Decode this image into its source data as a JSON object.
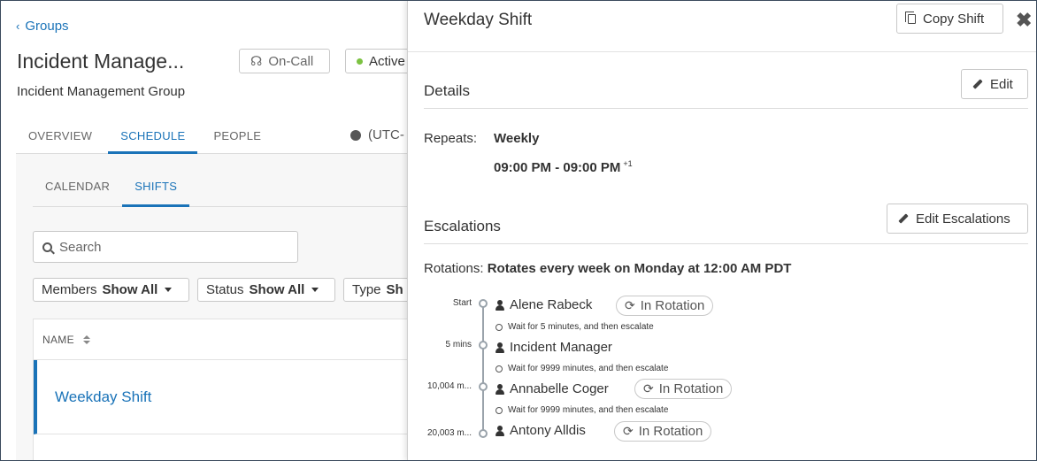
{
  "left": {
    "back_label": "Groups",
    "group_title": "Incident Manage...",
    "group_subtitle": "Incident Management Group",
    "oncall_label": "On-Call",
    "status_label": "Active",
    "tabs": [
      {
        "label": "OVERVIEW"
      },
      {
        "label": "SCHEDULE"
      },
      {
        "label": "PEOPLE"
      }
    ],
    "timezone": "(UTC-",
    "subtabs": [
      {
        "label": "CALENDAR"
      },
      {
        "label": "SHIFTS"
      }
    ],
    "search_placeholder": "Search",
    "filters": [
      {
        "label": "Members",
        "value": "Show All"
      },
      {
        "label": "Status",
        "value": "Show All"
      },
      {
        "label": "Type",
        "value": "Sh"
      }
    ],
    "table": {
      "column_name": "NAME",
      "rows": [
        "Weekday Shift"
      ]
    }
  },
  "panel": {
    "title": "Weekday Shift",
    "copy_label": "Copy Shift",
    "close_glyph": "✖",
    "details_heading": "Details",
    "edit_label": "Edit",
    "repeats_label": "Repeats:",
    "repeats_value": "Weekly",
    "time_range": "09:00 PM - 09:00 PM",
    "time_suffix": "+1",
    "escalations_heading": "Escalations",
    "edit_escalations_label": "Edit Escalations",
    "rotations_label": "Rotations:",
    "rotations_value": "Rotates every week on Monday at 12:00 AM PDT",
    "timeline": [
      {
        "offset": "Start",
        "name": "Alene Rabeck",
        "badge": "In Rotation",
        "wait": "Wait for 5 minutes, and then escalate"
      },
      {
        "offset": "5 mins",
        "name": "Incident Manager",
        "badge": "",
        "wait": "Wait for 9999 minutes, and then escalate"
      },
      {
        "offset": "10,004 m...",
        "name": "Annabelle Coger",
        "badge": "In Rotation",
        "wait": "Wait for 9999 minutes, and then escalate"
      },
      {
        "offset": "20,003 m...",
        "name": "Antony Alldis",
        "badge": "In Rotation",
        "wait": ""
      }
    ]
  },
  "colors": {
    "accent": "#1a73b8",
    "active_dot": "#7cc242"
  }
}
